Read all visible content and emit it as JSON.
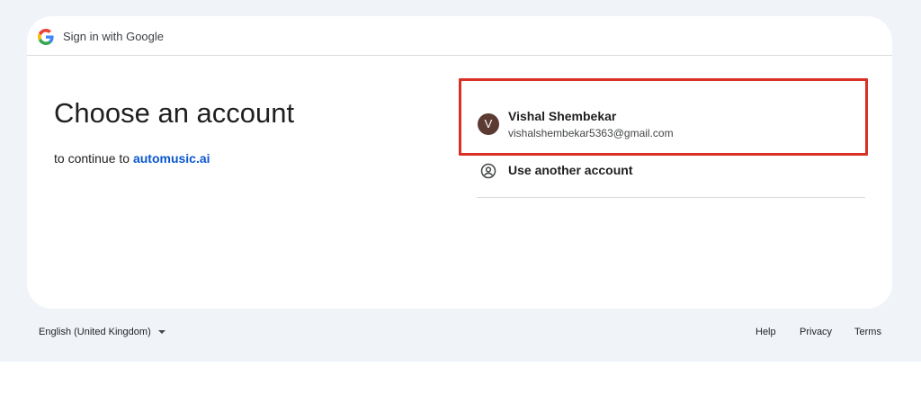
{
  "header": {
    "title": "Sign in with Google",
    "logo_icon": "google-g-icon"
  },
  "main": {
    "headline": "Choose an account",
    "subtitle_prefix": "to continue to",
    "app_name": "automusic.ai"
  },
  "accounts": [
    {
      "initial": "V",
      "name": "Vishal Shembekar",
      "email": "vishalshembekar5363@gmail.com",
      "avatar_color": "#5b3a32",
      "highlighted": true
    }
  ],
  "use_another": {
    "label": "Use another account",
    "icon": "person-circle-icon"
  },
  "footer": {
    "language": "English (United Kingdom)",
    "links": {
      "help": "Help",
      "privacy": "Privacy",
      "terms": "Terms"
    }
  },
  "colors": {
    "page_background": "#f0f4f9",
    "link": "#0b57d0",
    "highlight_border": "#d93025"
  }
}
